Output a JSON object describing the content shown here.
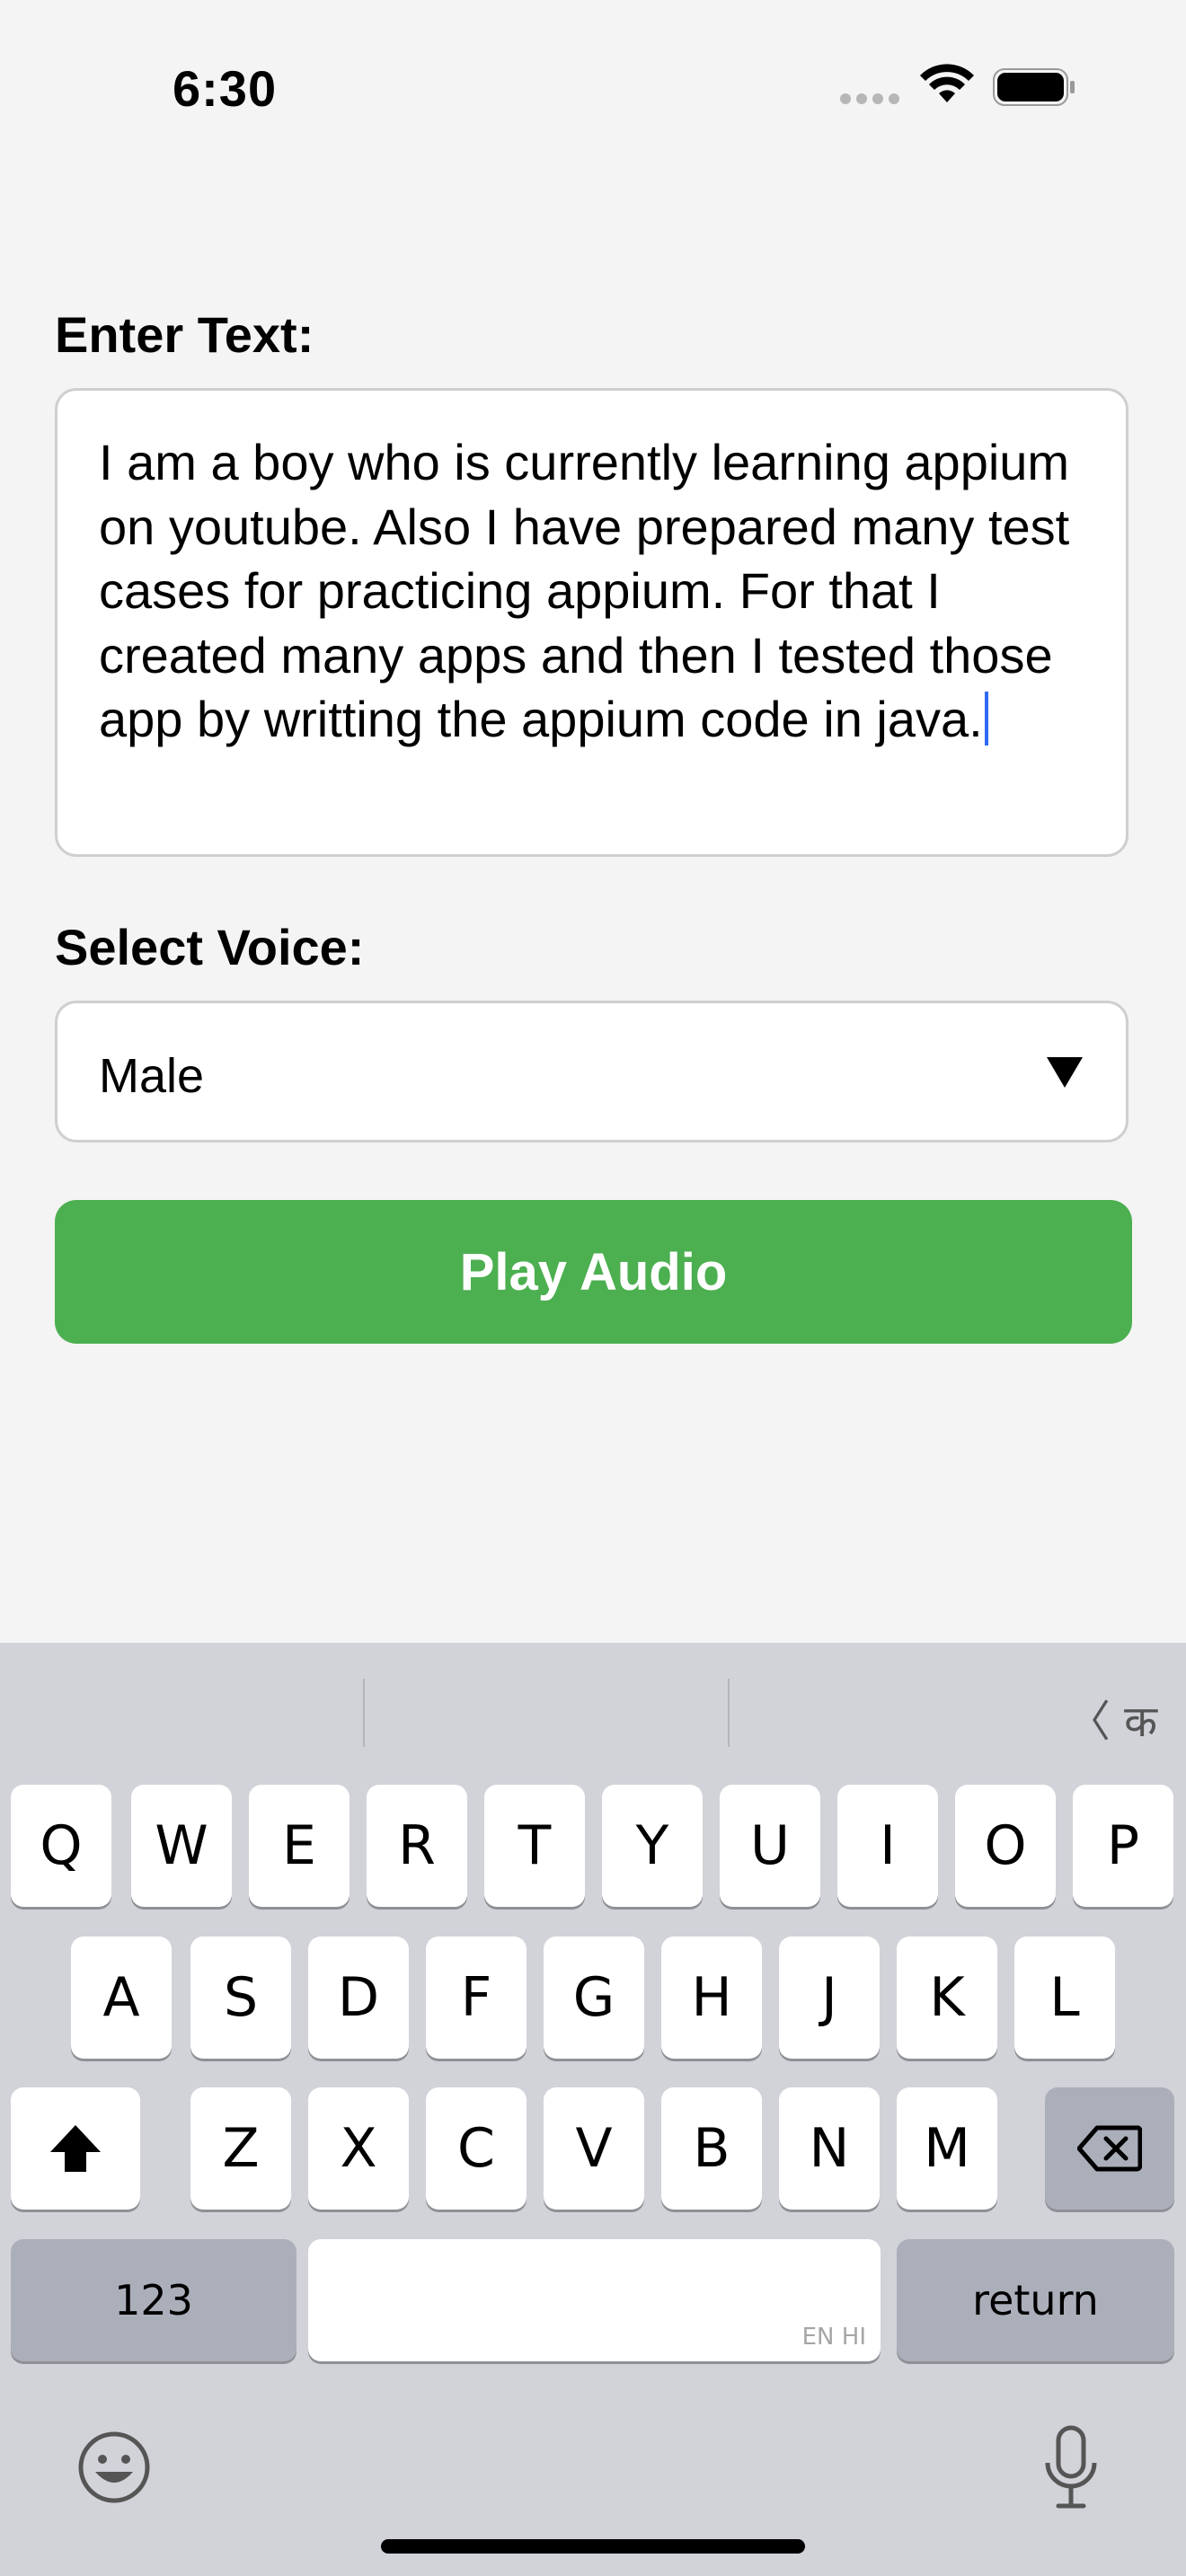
{
  "status_bar": {
    "time": "6:30",
    "icons": [
      "signal-dots-icon",
      "wifi-icon",
      "battery-icon"
    ]
  },
  "form": {
    "text_label": "Enter Text:",
    "text_value": "I am a boy who is currently learning appium on youtube. Also I have prepared many test cases for practicing appium. For that I created many apps and then I tested those app by writting the appium code in java.",
    "voice_label": "Select Voice:",
    "voice_selected": "Male",
    "play_button_label": "Play Audio"
  },
  "colors": {
    "background": "#f4f4f4",
    "play_button": "#4caf50",
    "caret": "#2f6bf2",
    "keyboard_bg": "#d1d3d9"
  },
  "keyboard": {
    "lang_switch_label": "〈 क",
    "row1": [
      "Q",
      "W",
      "E",
      "R",
      "T",
      "Y",
      "U",
      "I",
      "O",
      "P"
    ],
    "row2": [
      "A",
      "S",
      "D",
      "F",
      "G",
      "H",
      "J",
      "K",
      "L"
    ],
    "row3": [
      "Z",
      "X",
      "C",
      "V",
      "B",
      "N",
      "M"
    ],
    "numbers_key": "123",
    "space_hint": "EN HI",
    "return_key": "return",
    "shift_icon": "shift-icon",
    "delete_icon": "delete-icon",
    "emoji_icon": "emoji-icon",
    "mic_icon": "microphone-icon"
  }
}
